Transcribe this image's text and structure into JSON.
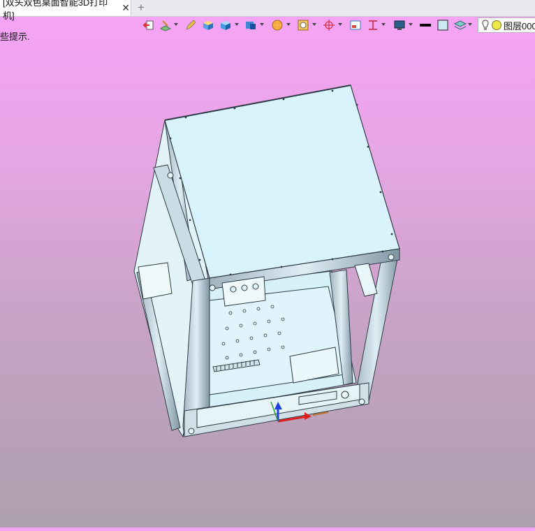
{
  "tab": {
    "title": "[双头双色桌面智能3D打印机]",
    "close_icon": "close-icon",
    "add_icon": "plus-icon"
  },
  "toolbar": {
    "buttons": [
      {
        "icon": "exit-icon"
      },
      {
        "icon": "sketch-icon"
      },
      {
        "icon": "pencil-icon"
      },
      {
        "icon": "box-shaded-icon"
      },
      {
        "icon": "cube-view-icon"
      },
      {
        "icon": "cube-display-icon"
      },
      {
        "icon": "render-style-icon"
      },
      {
        "icon": "target-icon"
      },
      {
        "icon": "frame-icon"
      },
      {
        "icon": "section-icon"
      },
      {
        "icon": "monitor-icon"
      },
      {
        "icon": "line-color-icon"
      },
      {
        "icon": "fill-color-icon"
      },
      {
        "icon": "layers-icon"
      }
    ],
    "layer_label": "图层000"
  },
  "hint": "些提示."
}
